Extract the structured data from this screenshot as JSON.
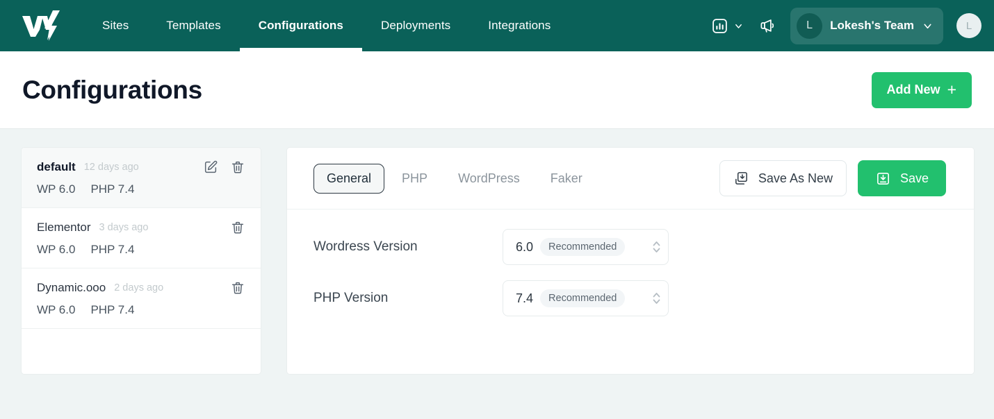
{
  "brand": {
    "logo_name": "w-lightning-logo",
    "header_bg": "#0a6159",
    "accent_green": "#22c06e"
  },
  "nav": {
    "items": [
      {
        "label": "Sites",
        "active": false
      },
      {
        "label": "Templates",
        "active": false
      },
      {
        "label": "Configurations",
        "active": true
      },
      {
        "label": "Deployments",
        "active": false
      },
      {
        "label": "Integrations",
        "active": false
      }
    ],
    "analytics_icon": "bar-chart-icon",
    "analytics_caret": "chevron-down-icon",
    "announcements_icon": "megaphone-icon",
    "team": {
      "avatar_initial": "L",
      "name": "Lokesh's Team",
      "caret": "chevron-down-icon"
    },
    "user_avatar_initial": "L"
  },
  "page": {
    "title": "Configurations",
    "add_new_label": "Add New",
    "add_new_plus": "+"
  },
  "sidebar": {
    "items": [
      {
        "name": "default",
        "age": "12 days ago",
        "wp": "WP 6.0",
        "php": "PHP 7.4",
        "selected": true,
        "has_edit": true
      },
      {
        "name": "Elementor",
        "age": "3 days ago",
        "wp": "WP 6.0",
        "php": "PHP 7.4",
        "selected": false,
        "has_edit": false
      },
      {
        "name": "Dynamic.ooo",
        "age": "2 days ago",
        "wp": "WP 6.0",
        "php": "PHP 7.4",
        "selected": false,
        "has_edit": false
      }
    ],
    "edit_icon": "edit-icon",
    "delete_icon": "trash-icon"
  },
  "panel": {
    "tabs": [
      {
        "label": "General",
        "active": true
      },
      {
        "label": "PHP",
        "active": false
      },
      {
        "label": "WordPress",
        "active": false
      },
      {
        "label": "Faker",
        "active": false
      }
    ],
    "save_as_new_label": "Save As New",
    "save_as_new_icon": "save-copy-icon",
    "save_label": "Save",
    "save_icon": "save-icon",
    "fields": [
      {
        "label": "Wordress Version",
        "value": "6.0",
        "badge": "Recommended",
        "stepper_icon": "chevron-up-down-icon"
      },
      {
        "label": "PHP Version",
        "value": "7.4",
        "badge": "Recommended",
        "stepper_icon": "chevron-up-down-icon"
      }
    ]
  }
}
